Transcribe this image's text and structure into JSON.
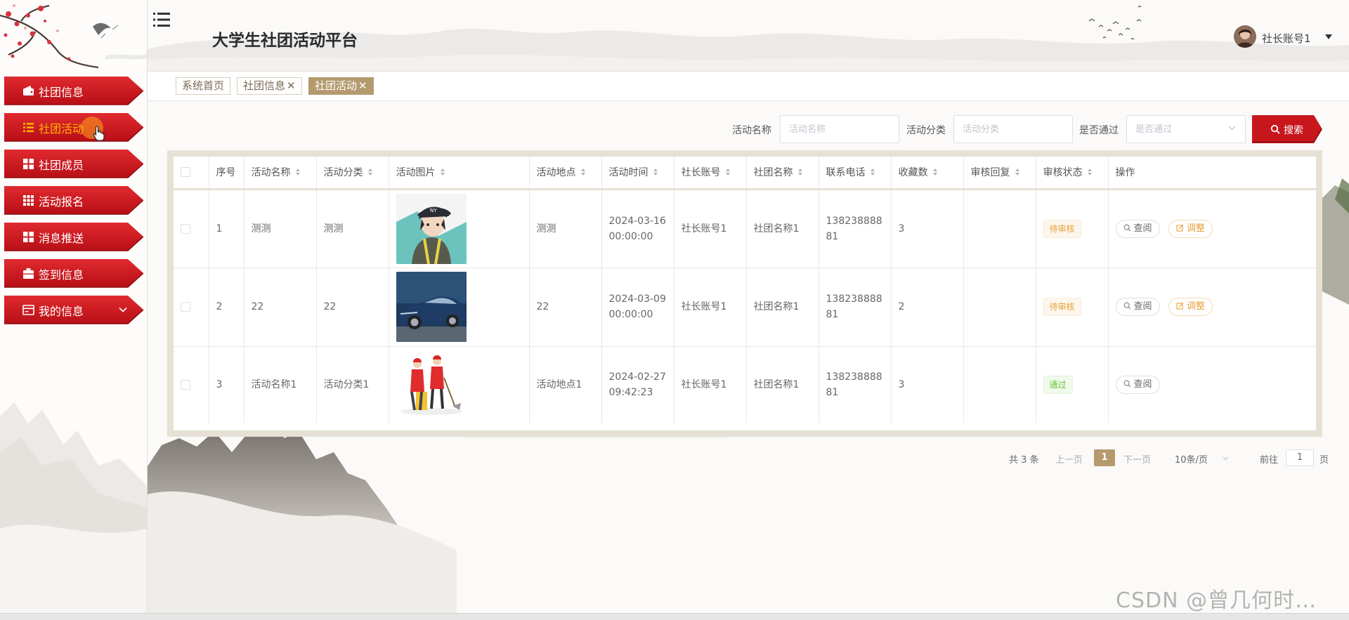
{
  "header": {
    "title": "大学生社团活动平台",
    "user_name": "社长账号1"
  },
  "sidebar": {
    "items": [
      {
        "label": "社团信息",
        "icon": "wallet-icon"
      },
      {
        "label": "社团活动",
        "icon": "list-icon"
      },
      {
        "label": "社团成员",
        "icon": "grid-icon"
      },
      {
        "label": "活动报名",
        "icon": "apps-icon"
      },
      {
        "label": "消息推送",
        "icon": "grid-icon"
      },
      {
        "label": "签到信息",
        "icon": "briefcase-icon"
      },
      {
        "label": "我的信息",
        "icon": "card-icon"
      }
    ],
    "active_index": 1
  },
  "tabs": [
    {
      "label": "系统首页",
      "closable": false
    },
    {
      "label": "社团信息",
      "closable": true
    },
    {
      "label": "社团活动",
      "closable": true,
      "active": true
    }
  ],
  "search": {
    "name_label": "活动名称",
    "name_placeholder": "活动名称",
    "category_label": "活动分类",
    "category_placeholder": "活动分类",
    "approved_label": "是否通过",
    "approved_placeholder": "是否通过",
    "button_label": "搜索"
  },
  "table": {
    "columns": [
      "序号",
      "活动名称",
      "活动分类",
      "活动图片",
      "活动地点",
      "活动时间",
      "社长账号",
      "社团名称",
      "联系电话",
      "收藏数",
      "审核回复",
      "审核状态",
      "操作"
    ],
    "rows": [
      {
        "index": "1",
        "name": "测测",
        "category": "测测",
        "image": "cartoon-boy-cap-image",
        "location": "测测",
        "time_date": "2024-03-16",
        "time_clock": "00:00:00",
        "leader": "社长账号1",
        "club": "社团名称1",
        "phone_a": "138238888",
        "phone_b": "81",
        "favorites": "3",
        "reply": "",
        "status": "待审核"
      },
      {
        "index": "2",
        "name": "22",
        "category": "22",
        "image": "blue-sedan-car-image",
        "location": "22",
        "time_date": "2024-03-09",
        "time_clock": "00:00:00",
        "leader": "社长账号1",
        "club": "社团名称1",
        "phone_a": "138238888",
        "phone_b": "81",
        "favorites": "2",
        "reply": "",
        "status": "待审核"
      },
      {
        "index": "3",
        "name": "活动名称1",
        "category": "活动分类1",
        "image": "volunteers-cleaning-image",
        "location": "活动地点1",
        "time_date": "2024-02-27",
        "time_clock": "09:42:23",
        "leader": "社长账号1",
        "club": "社团名称1",
        "phone_a": "138238888",
        "phone_b": "81",
        "favorites": "3",
        "reply": "",
        "status": "通过"
      }
    ],
    "actions": {
      "view": "查阅",
      "edit": "调整"
    }
  },
  "pagination": {
    "total_text": "共 3 条",
    "prev": "上一页",
    "current": "1",
    "next": "下一页",
    "page_size": "10条/页",
    "goto_label": "前往",
    "goto_value": "1",
    "goto_suffix": "页"
  },
  "watermark": "CSDN @曾几何时…",
  "colors": {
    "primary_red": "#c8161d",
    "accent_gold": "#b49a6e",
    "active_text": "#ffb400",
    "pending": "#e6a23c",
    "passed": "#67c23a"
  }
}
